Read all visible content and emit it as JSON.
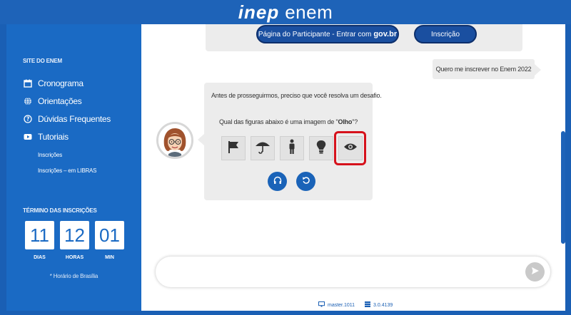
{
  "header": {
    "logo_inep": "inep",
    "logo_enem": "enem"
  },
  "sidebar": {
    "heading": "SITE DO ENEM",
    "items": [
      {
        "label": "Cronograma",
        "icon": "calendar-icon"
      },
      {
        "label": "Orientações",
        "icon": "globe-icon"
      },
      {
        "label": "Dúvidas Frequentes",
        "icon": "question-circle-icon"
      },
      {
        "label": "Tutoriais",
        "icon": "video-play-icon"
      }
    ],
    "subitems": [
      {
        "label": "Inscrições"
      },
      {
        "label": "Inscrições – em LIBRAS"
      }
    ],
    "termino_heading": "TÉRMINO DAS INSCRIÇÕES",
    "countdown": [
      {
        "value": "11",
        "label": "DIAS"
      },
      {
        "value": "12",
        "label": "HORAS"
      },
      {
        "value": "01",
        "label": "MIN"
      }
    ],
    "horario_note": "* Horário de Brasília"
  },
  "chat": {
    "top_buttons": {
      "participante_label": "Página do Participante - Entrar com",
      "participante_brand": "gov.br",
      "inscricao_label": "Inscrição"
    },
    "user_message": "Quero me inscrever no Enem 2022",
    "bot_message_1": "Antes de prosseguirmos, preciso que você resolva um desafio.",
    "bot_message_2_prefix": "Qual das figuras abaixo é uma imagem de \"",
    "bot_message_2_target": "Olho",
    "bot_message_2_suffix": "\"?",
    "figures": [
      {
        "icon": "flag-icon"
      },
      {
        "icon": "umbrella-icon"
      },
      {
        "icon": "person-icon"
      },
      {
        "icon": "lightbulb-icon"
      },
      {
        "icon": "eye-icon",
        "highlighted": true
      }
    ],
    "actions": [
      {
        "icon": "headphones-icon"
      },
      {
        "icon": "refresh-icon"
      }
    ],
    "input_placeholder": ""
  },
  "footer": {
    "build": "master.1011",
    "version": "3.0.4139"
  },
  "colors": {
    "brand_blue": "#1a63b8",
    "dark_blue_button": "#1a4fa0",
    "highlight_red": "#d6121c",
    "bubble_gray": "#ececec"
  }
}
